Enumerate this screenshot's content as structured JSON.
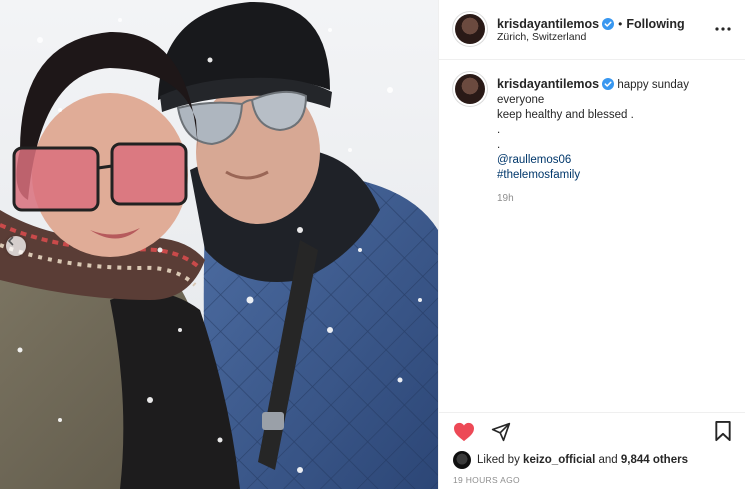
{
  "post": {
    "username": "krisdayantilemos",
    "location": "Zürich, Switzerland",
    "follow_dot": "•",
    "follow_status": "Following",
    "caption": {
      "username": "krisdayantilemos",
      "line1": "happy sunday",
      "line2": "everyone",
      "line3": "keep healthy and blessed .",
      "dot1": ".",
      "dot2": ".",
      "mention": "@raullemos06",
      "hashtag": "#thelemosfamily"
    },
    "time_ago": "19h",
    "liked_prefix": "Liked by",
    "liked_user": "keizo_official",
    "liked_and": "and",
    "likes_count": "9,844 others",
    "posted": "19 HOURS AGO"
  },
  "icons": {
    "verified": "verified-badge-icon",
    "more": "more-options-icon",
    "like": "heart-icon",
    "share": "send-icon",
    "save": "bookmark-icon",
    "carousel": "chevron-left-icon"
  },
  "colors": {
    "verified": "#3897f0",
    "like": "#ed4956",
    "link": "#00376b",
    "muted": "#8e8e8e"
  }
}
